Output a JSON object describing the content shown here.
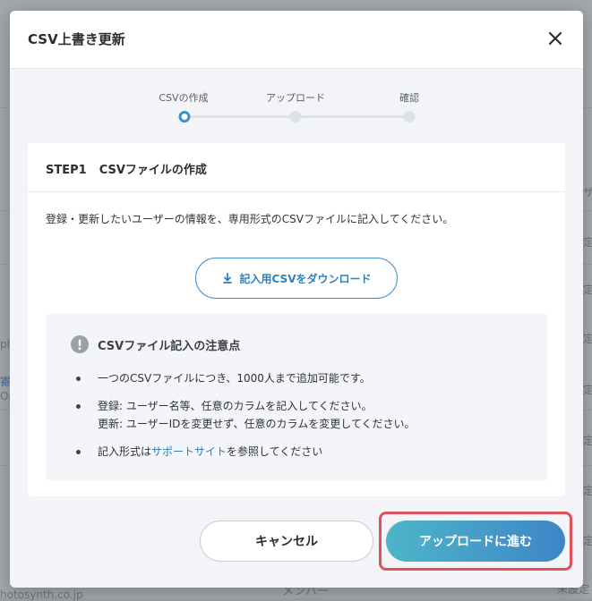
{
  "modal": {
    "title": "CSV上書き更新",
    "close_icon": "close-icon"
  },
  "stepper": {
    "steps": [
      {
        "label": "CSVの作成",
        "state": "active"
      },
      {
        "label": "アップロード",
        "state": "pending"
      },
      {
        "label": "確認",
        "state": "pending"
      }
    ]
  },
  "card": {
    "step_no": "STEP1",
    "title": "CSVファイルの作成",
    "description": "登録・更新したいユーザーの情報を、専用形式のCSVファイルに記入してください。",
    "download_button": "記入用CSVをダウンロード",
    "notes": {
      "title": "CSVファイル記入の注意点",
      "items": {
        "first": "一つのCSVファイルにつき、1000人まで追加可能です。",
        "second_line1": "登録: ユーザー名等、任意のカラムを記入してください。",
        "second_line2": "更新: ユーザーIDを変更せず、任意のカラムを変更してください。",
        "third_prefix": "記入形式は",
        "third_link": "サポートサイト",
        "third_suffix": "を参照してください"
      }
    }
  },
  "footer": {
    "cancel": "キャンセル",
    "next": "アップロードに進む"
  },
  "background": {
    "fragments": [
      "ph",
      "寄",
      "Op",
      "定",
      "定",
      "定",
      "定",
      "定",
      "定",
      "定",
      "ザ",
      "メンバー",
      "未設定",
      "hotosynth.co.jp"
    ]
  },
  "colors": {
    "accent": "#3f8fc8",
    "highlight": "#e0505a"
  }
}
